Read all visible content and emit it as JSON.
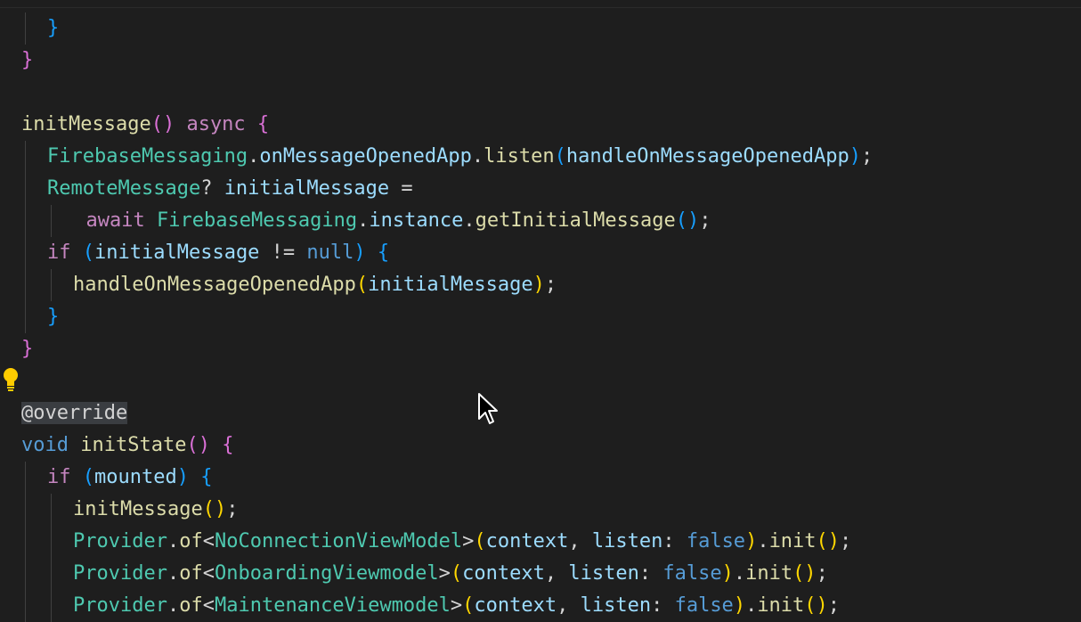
{
  "editor": {
    "lines": [
      {
        "indent": 2,
        "tokens": [
          {
            "t": "}",
            "c": "br2"
          }
        ]
      },
      {
        "indent": 1,
        "tokens": [
          {
            "t": "}",
            "c": "br1"
          }
        ]
      },
      {
        "indent": 0,
        "tokens": []
      },
      {
        "indent": 1,
        "tokens": [
          {
            "t": "initMessage",
            "c": "fn"
          },
          {
            "t": "()",
            "c": "br1"
          },
          {
            "t": " async ",
            "c": "kw"
          },
          {
            "t": "{",
            "c": "br1"
          }
        ]
      },
      {
        "indent": 2,
        "tokens": [
          {
            "t": "FirebaseMessaging",
            "c": "type"
          },
          {
            "t": ".",
            "c": "plain"
          },
          {
            "t": "onMessageOpenedApp",
            "c": "var"
          },
          {
            "t": ".",
            "c": "plain"
          },
          {
            "t": "listen",
            "c": "fn"
          },
          {
            "t": "(",
            "c": "br2"
          },
          {
            "t": "handleOnMessageOpenedApp",
            "c": "var"
          },
          {
            "t": ")",
            "c": "br2"
          },
          {
            "t": ";",
            "c": "plain"
          }
        ]
      },
      {
        "indent": 2,
        "tokens": [
          {
            "t": "RemoteMessage",
            "c": "type"
          },
          {
            "t": "? ",
            "c": "plain"
          },
          {
            "t": "initialMessage",
            "c": "var"
          },
          {
            "t": " =",
            "c": "plain"
          }
        ]
      },
      {
        "indent": 3.5,
        "tokens": [
          {
            "t": "await ",
            "c": "kw"
          },
          {
            "t": "FirebaseMessaging",
            "c": "type"
          },
          {
            "t": ".",
            "c": "plain"
          },
          {
            "t": "instance",
            "c": "var"
          },
          {
            "t": ".",
            "c": "plain"
          },
          {
            "t": "getInitialMessage",
            "c": "fn"
          },
          {
            "t": "()",
            "c": "br2"
          },
          {
            "t": ";",
            "c": "plain"
          }
        ]
      },
      {
        "indent": 2,
        "tokens": [
          {
            "t": "if ",
            "c": "kw"
          },
          {
            "t": "(",
            "c": "br2"
          },
          {
            "t": "initialMessage",
            "c": "var"
          },
          {
            "t": " != ",
            "c": "plain"
          },
          {
            "t": "null",
            "c": "kw2"
          },
          {
            "t": ") ",
            "c": "br2"
          },
          {
            "t": "{",
            "c": "br2"
          }
        ]
      },
      {
        "indent": 3,
        "tokens": [
          {
            "t": "handleOnMessageOpenedApp",
            "c": "fn"
          },
          {
            "t": "(",
            "c": "br3"
          },
          {
            "t": "initialMessage",
            "c": "var"
          },
          {
            "t": ")",
            "c": "br3"
          },
          {
            "t": ";",
            "c": "plain"
          }
        ]
      },
      {
        "indent": 2,
        "tokens": [
          {
            "t": "}",
            "c": "br2"
          }
        ]
      },
      {
        "indent": 1,
        "tokens": [
          {
            "t": "}",
            "c": "br1"
          }
        ]
      },
      {
        "indent": 0,
        "tokens": []
      },
      {
        "indent": 1,
        "hl": true,
        "tokens": [
          {
            "t": "@override",
            "c": "plain"
          }
        ]
      },
      {
        "indent": 1,
        "tokens": [
          {
            "t": "void ",
            "c": "kw2"
          },
          {
            "t": "initState",
            "c": "fn"
          },
          {
            "t": "() ",
            "c": "br1"
          },
          {
            "t": "{",
            "c": "br1"
          }
        ]
      },
      {
        "indent": 2,
        "tokens": [
          {
            "t": "if ",
            "c": "kw"
          },
          {
            "t": "(",
            "c": "br2"
          },
          {
            "t": "mounted",
            "c": "var"
          },
          {
            "t": ") ",
            "c": "br2"
          },
          {
            "t": "{",
            "c": "br2"
          }
        ]
      },
      {
        "indent": 3,
        "tokens": [
          {
            "t": "initMessage",
            "c": "fn"
          },
          {
            "t": "()",
            "c": "br3"
          },
          {
            "t": ";",
            "c": "plain"
          }
        ]
      },
      {
        "indent": 3,
        "tokens": [
          {
            "t": "Provider",
            "c": "type"
          },
          {
            "t": ".",
            "c": "plain"
          },
          {
            "t": "of",
            "c": "fn"
          },
          {
            "t": "<",
            "c": "plain"
          },
          {
            "t": "NoConnectionViewModel",
            "c": "type"
          },
          {
            "t": ">",
            "c": "plain"
          },
          {
            "t": "(",
            "c": "br3"
          },
          {
            "t": "context",
            "c": "var"
          },
          {
            "t": ", ",
            "c": "plain"
          },
          {
            "t": "listen",
            "c": "var"
          },
          {
            "t": ": ",
            "c": "plain"
          },
          {
            "t": "false",
            "c": "kw2"
          },
          {
            "t": ")",
            "c": "br3"
          },
          {
            "t": ".",
            "c": "plain"
          },
          {
            "t": "init",
            "c": "fn"
          },
          {
            "t": "()",
            "c": "br3"
          },
          {
            "t": ";",
            "c": "plain"
          }
        ]
      },
      {
        "indent": 3,
        "tokens": [
          {
            "t": "Provider",
            "c": "type"
          },
          {
            "t": ".",
            "c": "plain"
          },
          {
            "t": "of",
            "c": "fn"
          },
          {
            "t": "<",
            "c": "plain"
          },
          {
            "t": "OnboardingViewmodel",
            "c": "type"
          },
          {
            "t": ">",
            "c": "plain"
          },
          {
            "t": "(",
            "c": "br3"
          },
          {
            "t": "context",
            "c": "var"
          },
          {
            "t": ", ",
            "c": "plain"
          },
          {
            "t": "listen",
            "c": "var"
          },
          {
            "t": ": ",
            "c": "plain"
          },
          {
            "t": "false",
            "c": "kw2"
          },
          {
            "t": ")",
            "c": "br3"
          },
          {
            "t": ".",
            "c": "plain"
          },
          {
            "t": "init",
            "c": "fn"
          },
          {
            "t": "()",
            "c": "br3"
          },
          {
            "t": ";",
            "c": "plain"
          }
        ]
      },
      {
        "indent": 3,
        "tokens": [
          {
            "t": "Provider",
            "c": "type"
          },
          {
            "t": ".",
            "c": "plain"
          },
          {
            "t": "of",
            "c": "fn"
          },
          {
            "t": "<",
            "c": "plain"
          },
          {
            "t": "MaintenanceViewmodel",
            "c": "type"
          },
          {
            "t": ">",
            "c": "plain"
          },
          {
            "t": "(",
            "c": "br3"
          },
          {
            "t": "context",
            "c": "var"
          },
          {
            "t": ", ",
            "c": "plain"
          },
          {
            "t": "listen",
            "c": "var"
          },
          {
            "t": ": ",
            "c": "plain"
          },
          {
            "t": "false",
            "c": "kw2"
          },
          {
            "t": ")",
            "c": "br3"
          },
          {
            "t": ".",
            "c": "plain"
          },
          {
            "t": "init",
            "c": "fn"
          },
          {
            "t": "()",
            "c": "br3"
          },
          {
            "t": ";",
            "c": "plain"
          }
        ]
      }
    ]
  },
  "icons": {
    "lightbulb": "lightbulb-icon",
    "cursor": "mouse-pointer-icon"
  },
  "colors": {
    "background": "#1e1e1e",
    "function": "#dcdcaa",
    "keyword": "#c586c0",
    "type": "#4ec9b0",
    "variable": "#9cdcfe",
    "bulb": "#ffcc00"
  }
}
